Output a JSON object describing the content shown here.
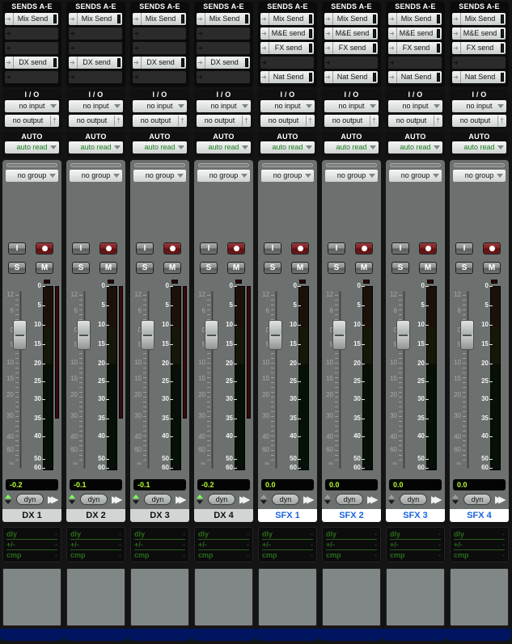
{
  "labels": {
    "sends_header": "SENDS A-E",
    "io_header": "I / O",
    "auto_header": "AUTO",
    "input_button": "I",
    "solo_button": "S",
    "mute_button": "M",
    "dyn_button": "dyn",
    "comment_rows": [
      "dly",
      "+/-",
      "cmp"
    ],
    "comment_value": "-"
  },
  "fader_scale": [
    "12",
    "6",
    "0",
    "5",
    "10",
    "15",
    "20",
    "30",
    "40",
    "60",
    "∞"
  ],
  "meter_scale": [
    "0",
    "5",
    "10",
    "15",
    "20",
    "25",
    "30",
    "35",
    "40",
    "50",
    "60"
  ],
  "colors": {
    "volume_text": "#b9ff2e",
    "sfx_name": "#1a63e0",
    "auto_read": "#1c7e1c",
    "record_button": "#7c1e1e",
    "footer": "#001560"
  },
  "channels": [
    {
      "name": "DX 1",
      "type": "dx",
      "volume": "-0.2",
      "sends": [
        "Mix Send",
        "",
        "",
        "DX send",
        ""
      ],
      "input": "no input",
      "output": "no output",
      "automation": "auto read",
      "group": "no group",
      "peak_hold_db": 35
    },
    {
      "name": "DX 2",
      "type": "dx",
      "volume": "-0.1",
      "sends": [
        "Mix Send",
        "",
        "",
        "DX send",
        ""
      ],
      "input": "no input",
      "output": "no output",
      "automation": "auto read",
      "group": "no group",
      "peak_hold_db": 35
    },
    {
      "name": "DX 3",
      "type": "dx",
      "volume": "-0.1",
      "sends": [
        "Mix Send",
        "",
        "",
        "DX send",
        ""
      ],
      "input": "no input",
      "output": "no output",
      "automation": "auto read",
      "group": "no group",
      "peak_hold_db": 35
    },
    {
      "name": "DX 4",
      "type": "dx",
      "volume": "-0.2",
      "sends": [
        "Mix Send",
        "",
        "",
        "DX send",
        ""
      ],
      "input": "no input",
      "output": "no output",
      "automation": "auto read",
      "group": "no group",
      "peak_hold_db": 35
    },
    {
      "name": "SFX 1",
      "type": "sfx",
      "volume": "0.0",
      "sends": [
        "Mix Send",
        "M&E send",
        "FX send",
        "",
        "Nat Send"
      ],
      "input": "no input",
      "output": "no output",
      "automation": "auto read",
      "group": "no group",
      "peak_hold_db": null
    },
    {
      "name": "SFX 2",
      "type": "sfx",
      "volume": "0.0",
      "sends": [
        "Mix Send",
        "M&E send",
        "FX send",
        "",
        "Nat Send"
      ],
      "input": "no input",
      "output": "no output",
      "automation": "auto read",
      "group": "no group",
      "peak_hold_db": null
    },
    {
      "name": "SFX 3",
      "type": "sfx",
      "volume": "0.0",
      "sends": [
        "Mix Send",
        "M&E send",
        "FX send",
        "",
        "Nat Send"
      ],
      "input": "no input",
      "output": "no output",
      "automation": "auto read",
      "group": "no group",
      "peak_hold_db": null
    },
    {
      "name": "SFX 4",
      "type": "sfx",
      "volume": "0.0",
      "sends": [
        "Mix Send",
        "M&E send",
        "FX send",
        "",
        "Nat Send"
      ],
      "input": "no input",
      "output": "no output",
      "automation": "auto read",
      "group": "no group",
      "peak_hold_db": null
    }
  ]
}
